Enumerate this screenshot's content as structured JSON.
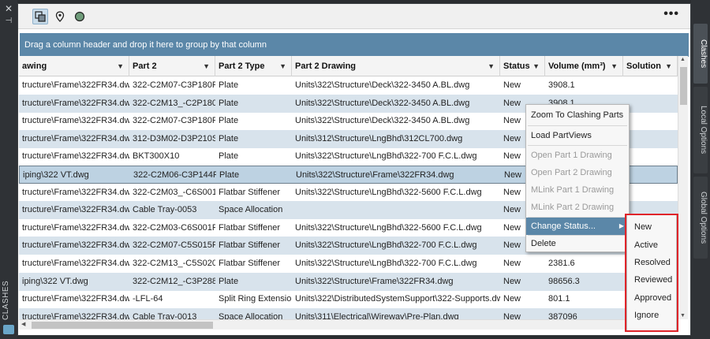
{
  "left_panel": {
    "close_glyph": "✕",
    "pin_glyph": "⊣",
    "label": "CLASHES",
    "logo_icon": "app-logo-icon"
  },
  "toolbar": {
    "icons": [
      "clash-view-icon",
      "location-pin-icon",
      "globe-icon"
    ],
    "more": "•••"
  },
  "group_bar": {
    "text": "Drag a column header and drop it here to group by that column"
  },
  "grid": {
    "columns": [
      {
        "label": "awing"
      },
      {
        "label": "Part 2"
      },
      {
        "label": "Part 2 Type"
      },
      {
        "label": "Part 2 Drawing"
      },
      {
        "label": "Status"
      },
      {
        "label": "Volume (mm³)"
      },
      {
        "label": "Solution"
      }
    ],
    "rows": [
      [
        "tructure\\Frame\\322FR34.dwg",
        "322-C2M07-C3P180P",
        "Plate",
        "Units\\322\\Structure\\Deck\\322-3450 A.BL.dwg",
        "New",
        "3908.1",
        ""
      ],
      [
        "tructure\\Frame\\322FR34.dwg",
        "322-C2M13_-C2P180S",
        "Plate",
        "Units\\322\\Structure\\Deck\\322-3450 A.BL.dwg",
        "New",
        "3908.1",
        ""
      ],
      [
        "tructure\\Frame\\322FR34.dwg",
        "322-C2M07-C3P180P",
        "Plate",
        "Units\\322\\Structure\\Deck\\322-3450 A.BL.dwg",
        "New",
        "",
        ""
      ],
      [
        "tructure\\Frame\\322FR34.dwg",
        "312-D3M02-D3P210S",
        "Plate",
        "Units\\312\\Structure\\LngBhd\\312CL700.dwg",
        "New",
        "",
        ""
      ],
      [
        "tructure\\Frame\\322FR34.dwg",
        "BKT300X10",
        "Plate",
        "Units\\322\\Structure\\LngBhd\\322-700 F.C.L.dwg",
        "New",
        "",
        ""
      ],
      [
        "iping\\322 VT.dwg",
        "322-C2M06-C3P144P",
        "Plate",
        "Units\\322\\Structure\\Frame\\322FR34.dwg",
        "New",
        "",
        ""
      ],
      [
        "tructure\\Frame\\322FR34.dwg",
        "322-C2M03_-C6S001S",
        "Flatbar Stiffener",
        "Units\\322\\Structure\\LngBhd\\322-5600 F.C.L.dwg",
        "New",
        "",
        ""
      ],
      [
        "tructure\\Frame\\322FR34.dwg",
        "Cable Tray-0053",
        "Space Allocation",
        "",
        "New",
        "",
        ""
      ],
      [
        "tructure\\Frame\\322FR34.dwg",
        "322-C2M03-C6S001P",
        "Flatbar Stiffener",
        "Units\\322\\Structure\\LngBhd\\322-5600 F.C.L.dwg",
        "New",
        "",
        ""
      ],
      [
        "tructure\\Frame\\322FR34.dwg",
        "322-C2M07-C5S015P",
        "Flatbar Stiffener",
        "Units\\322\\Structure\\LngBhd\\322-700 F.C.L.dwg",
        "New",
        "",
        ""
      ],
      [
        "tructure\\Frame\\322FR34.dwg",
        "322-C2M13_-C5S020S",
        "Flatbar Stiffener",
        "Units\\322\\Structure\\LngBhd\\322-700 F.C.L.dwg",
        "New",
        "2381.6",
        ""
      ],
      [
        "iping\\322 VT.dwg",
        "322-C2M12_-C3P288S",
        "Plate",
        "Units\\322\\Structure\\Frame\\322FR34.dwg",
        "New",
        "98656.3",
        ""
      ],
      [
        "tructure\\Frame\\322FR34.dwg",
        "-LFL-64",
        "Split Ring Extension",
        "Units\\322\\DistributedSystemSupport\\322-Supports.dwg",
        "New",
        "801.1",
        ""
      ],
      [
        "tructure\\Frame\\322FR34.dwg",
        "Cable Tray-0013",
        "Space Allocation",
        "Units\\311\\Electrical\\Wireway\\Pre-Plan.dwg",
        "New",
        "387096",
        ""
      ]
    ]
  },
  "context_menu": {
    "items": [
      {
        "label": "Zoom To Clashing Parts",
        "enabled": true
      },
      {
        "label": "Load PartViews",
        "enabled": true
      },
      {
        "label": "Open Part 1 Drawing",
        "enabled": false
      },
      {
        "label": "Open Part 2 Drawing",
        "enabled": false
      },
      {
        "label": "MLink Part 1 Drawing",
        "enabled": false
      },
      {
        "label": "MLink Part 2 Drawing",
        "enabled": false
      },
      {
        "label": "Change Status...",
        "enabled": true,
        "submenu": true
      },
      {
        "label": "Delete",
        "enabled": true
      }
    ]
  },
  "status_submenu": {
    "items": [
      "New",
      "Active",
      "Resolved",
      "Reviewed",
      "Approved",
      "Ignore"
    ],
    "highlight_color": "#e0242a"
  },
  "right_tabs": [
    "Clashes",
    "Local Options",
    "Global Options"
  ],
  "colors": {
    "accent": "#5b87a8",
    "row_alt": "#d8e3ec"
  }
}
